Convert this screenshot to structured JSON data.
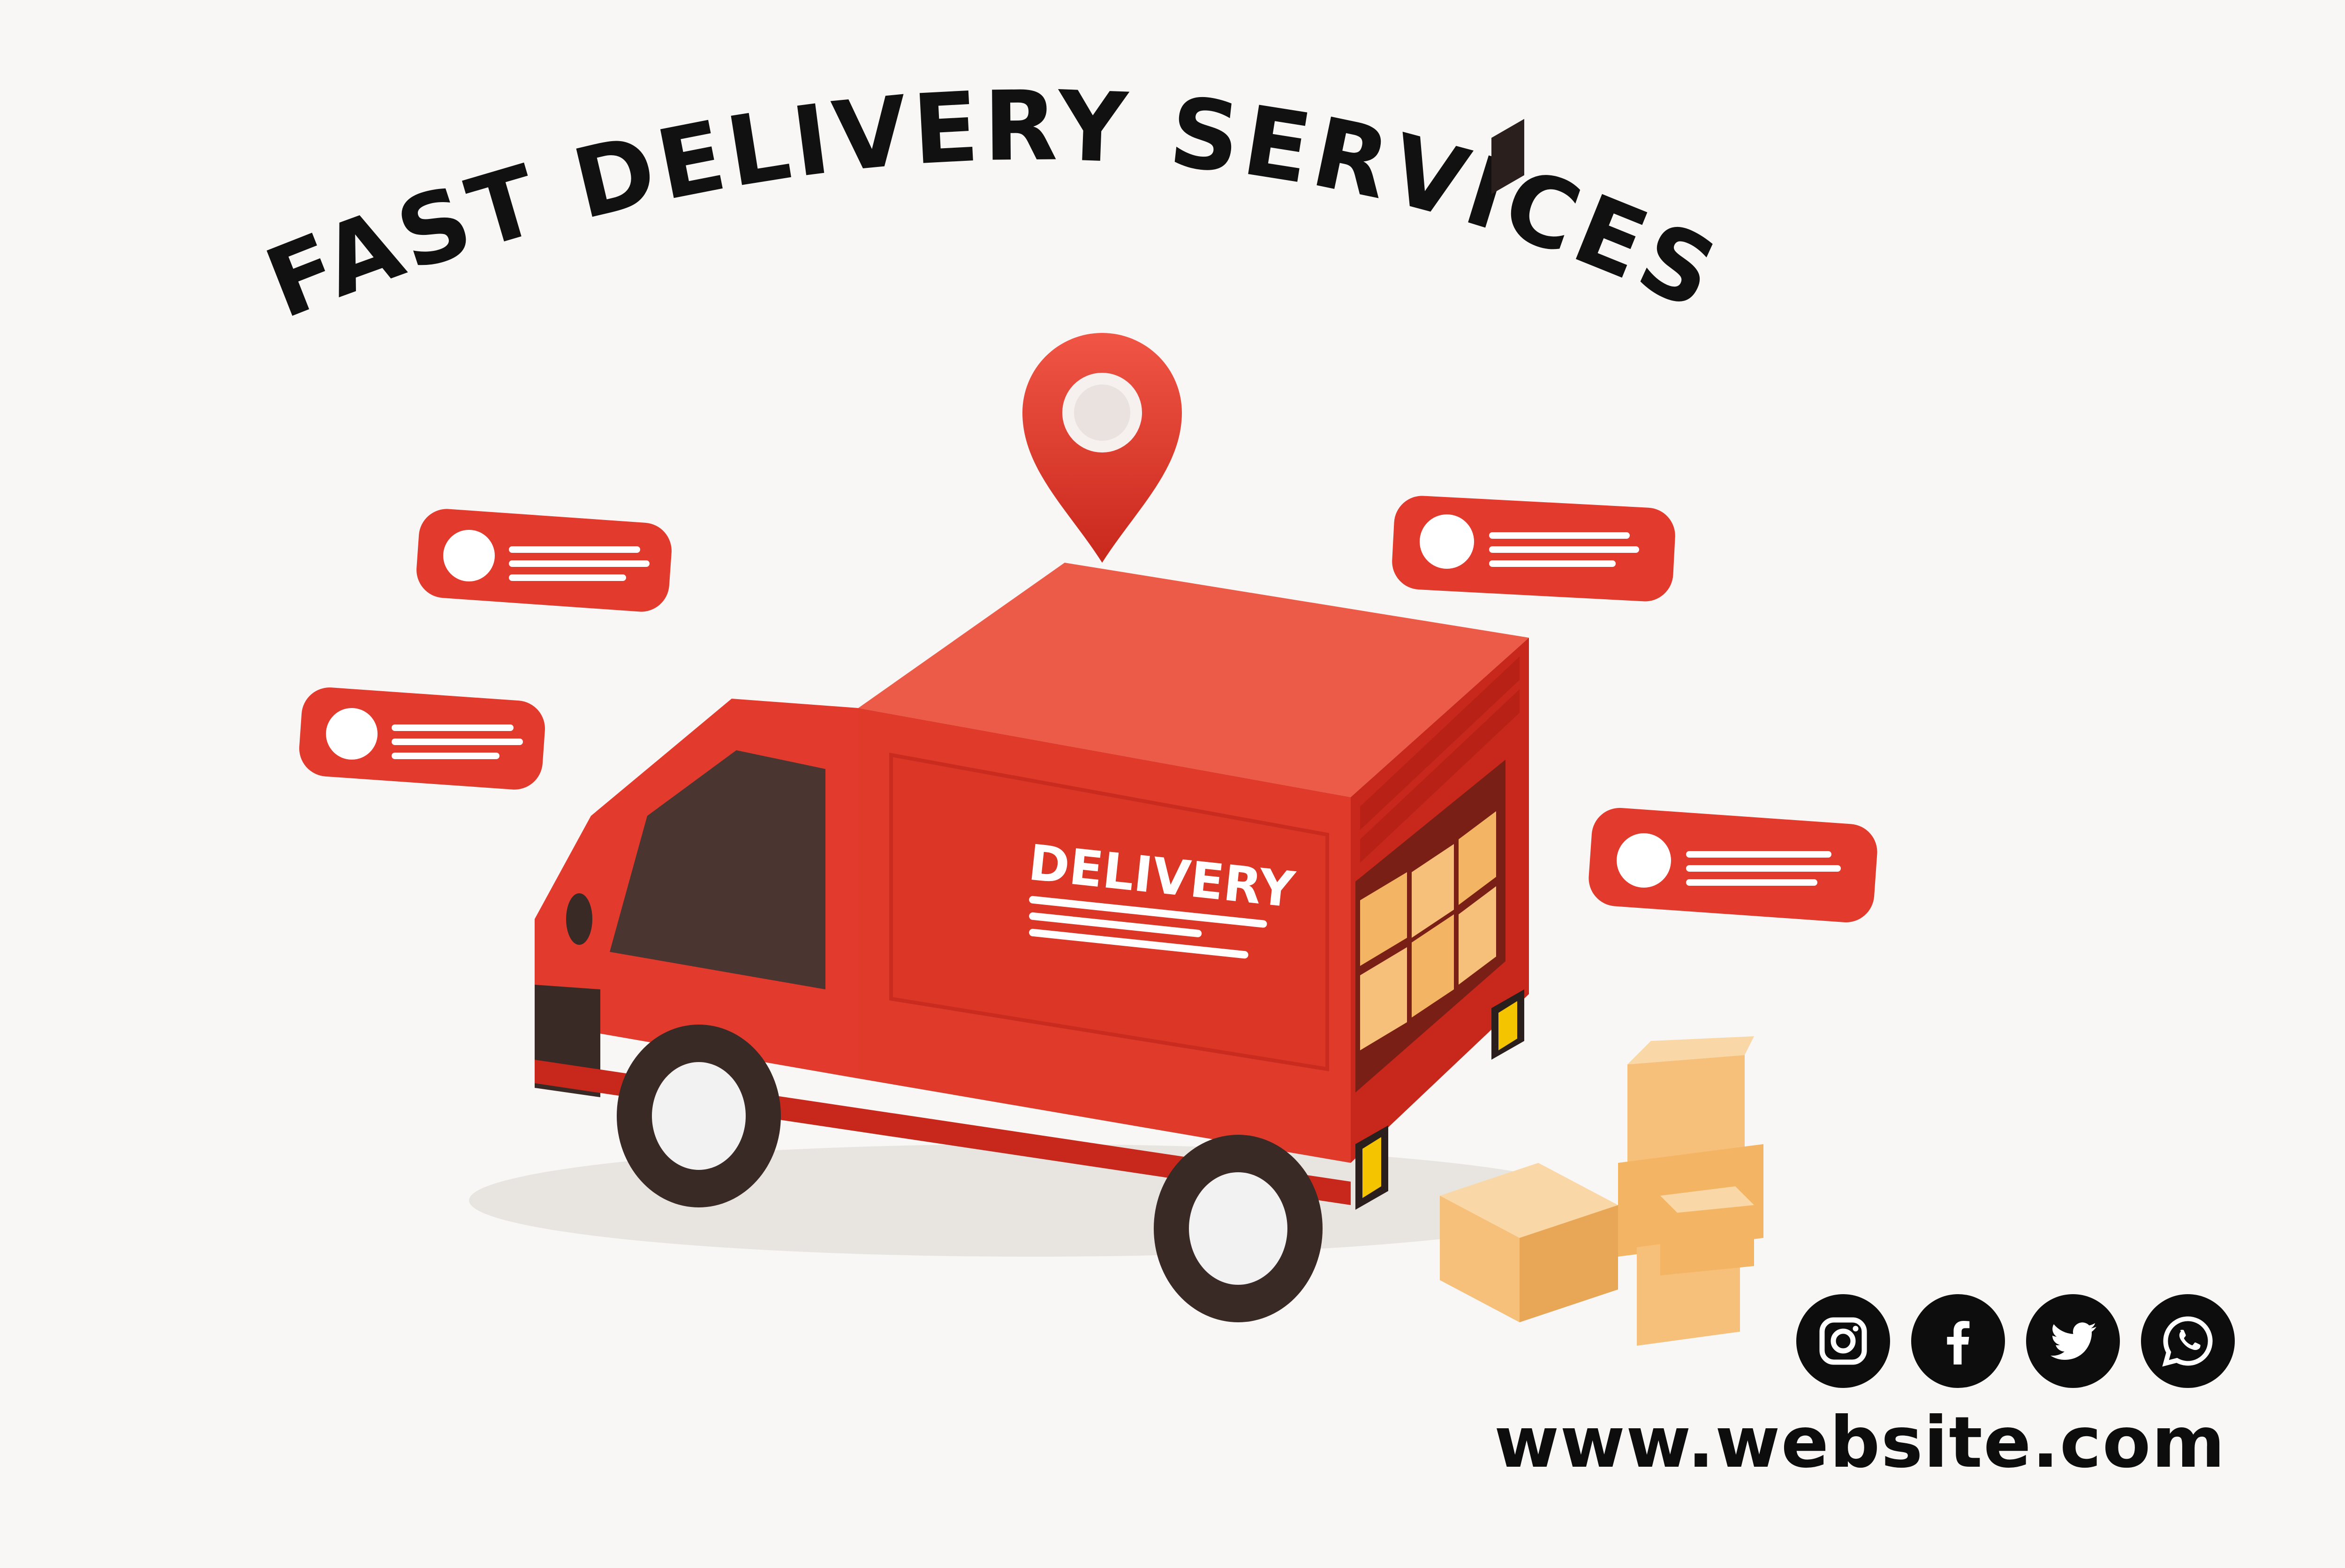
{
  "title": "FAST DELIVERY SERVICES",
  "truck": {
    "label": "DELIVERY"
  },
  "website": "www.website.com",
  "social_icons": [
    "instagram-icon",
    "facebook-icon",
    "twitter-icon",
    "whatsapp-icon"
  ],
  "colors": {
    "accent": "#e23a2c",
    "accent_dark": "#b8231a",
    "box": "#f7c07a",
    "text": "#111111",
    "background": "#f8f7f5"
  }
}
